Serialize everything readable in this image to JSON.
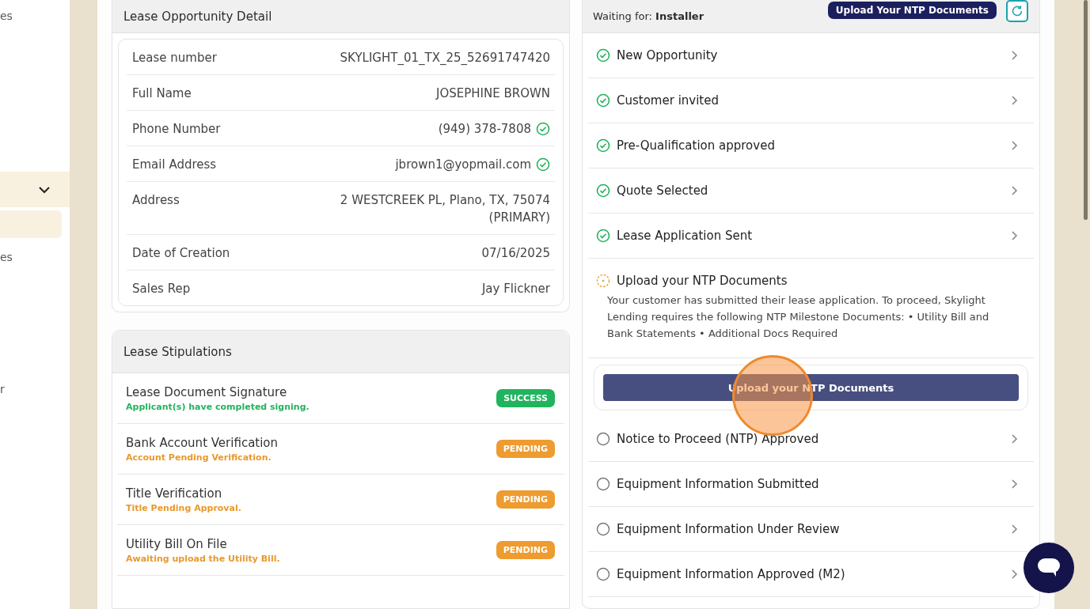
{
  "sidebar": {
    "items": [
      {
        "kind": "text",
        "label": "es",
        "selected": false
      },
      {
        "kind": "group",
        "expanded": true,
        "selected": true
      },
      {
        "kind": "blank",
        "selected": true
      },
      {
        "kind": "text",
        "label": "es",
        "selected": false
      },
      {
        "kind": "text",
        "label": "r",
        "selected": false
      }
    ]
  },
  "detail": {
    "title": "Lease Opportunity Detail",
    "rows": [
      {
        "label": "Lease number",
        "value": "SKYLIGHT_01_TX_25_52691747420",
        "verified": false
      },
      {
        "label": "Full Name",
        "value": "JOSEPHINE BROWN",
        "verified": false
      },
      {
        "label": "Phone Number",
        "value": "(949) 378-7808",
        "verified": true
      },
      {
        "label": "Email Address",
        "value": "jbrown1@yopmail.com",
        "verified": true
      },
      {
        "label": "Address",
        "value": "2 WESTCREEK PL, Plano, TX, 75074",
        "value_2": "(PRIMARY)",
        "verified": false
      },
      {
        "label": "Date of Creation",
        "value": "07/16/2025",
        "verified": false
      },
      {
        "label": "Sales Rep",
        "value": "Jay Flickner",
        "verified": false
      }
    ]
  },
  "stipulations": {
    "title": "Lease Stipulations",
    "rows": [
      {
        "title": "Lease Document Signature",
        "note": "Applicant(s) have completed signing.",
        "kind": "success",
        "badge": "SUCCESS"
      },
      {
        "title": "Bank Account Verification",
        "note": "Account Pending Verification.",
        "kind": "pending",
        "badge": "PENDING"
      },
      {
        "title": "Title Verification",
        "note": "Title Pending Approval.",
        "kind": "pending",
        "badge": "PENDING"
      },
      {
        "title": "Utility Bill On File",
        "note": "Awaiting upload the Utility Bill.",
        "kind": "pending",
        "badge": "PENDING"
      }
    ]
  },
  "progress": {
    "waiting_label": "Waiting for:",
    "waiting_value": "Installer",
    "header_button": "Upload Your NTP Documents",
    "steps": [
      {
        "label": "New Opportunity",
        "kind": "done"
      },
      {
        "label": "Customer invited",
        "kind": "done"
      },
      {
        "label": "Pre-Qualification approved",
        "kind": "done"
      },
      {
        "label": "Quote Selected",
        "kind": "done"
      },
      {
        "label": "Lease Application Sent",
        "kind": "done"
      },
      {
        "label": "Upload your NTP Documents",
        "kind": "current",
        "description": "Your customer has submitted their lease application. To proceed, Skylight Lending requires the following NTP Milestone Documents: • Utility Bill and Bank Statements • Additional Docs Required",
        "button": "Upload your NTP Documents"
      },
      {
        "label": "Notice to Proceed (NTP) Approved",
        "kind": "todo"
      },
      {
        "label": "Equipment Information Submitted",
        "kind": "todo"
      },
      {
        "label": "Equipment Information Under Review",
        "kind": "todo"
      },
      {
        "label": "Equipment Information Approved (M2)",
        "kind": "todo"
      }
    ]
  }
}
